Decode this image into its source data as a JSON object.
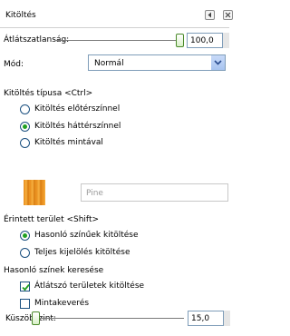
{
  "panel": {
    "title": "Kitöltés"
  },
  "opacity": {
    "label": "Átlátszatlanság:",
    "value": "100,0",
    "level": 1.0
  },
  "mode": {
    "label": "Mód:",
    "selected": "Normál"
  },
  "fill_type": {
    "heading": "Kitöltés típusa  <Ctrl>",
    "options": [
      "Kitöltés előtérszínnel",
      "Kitöltés háttérszínnel",
      "Kitöltés mintával"
    ],
    "selected_index": 1,
    "pattern_name": "Pine"
  },
  "affected_area": {
    "heading": "Érintett terület  <Shift>",
    "options": [
      "Hasonló színűek kitöltése",
      "Teljes kijelölés kitöltése"
    ],
    "selected_index": 0
  },
  "similar": {
    "heading": "Hasonló színek keresése",
    "transparent_label": "Átlátszó területek kitöltése",
    "transparent_checked": true,
    "sample_merged_label": "Mintakeverés",
    "sample_merged_checked": false
  },
  "threshold": {
    "label": "Küszöbszint:",
    "value": "15,0"
  }
}
